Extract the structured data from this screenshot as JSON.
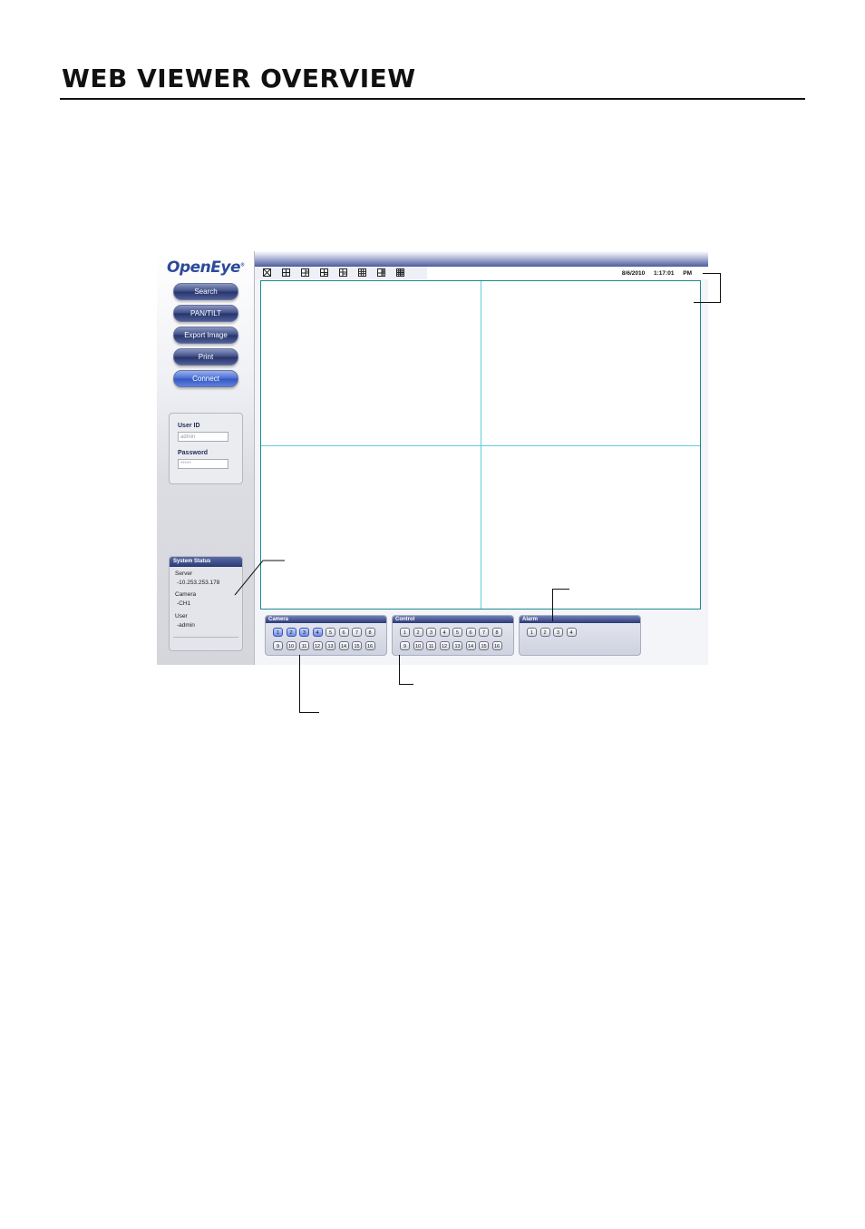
{
  "page": {
    "title": "WEB VIEWER OVERVIEW"
  },
  "app": {
    "logo": "OpenEye",
    "logo_mark": "®",
    "buttons": [
      "Search",
      "PAN/TILT",
      "Export Image",
      "Print",
      "Connect"
    ],
    "login": {
      "user_id_label": "User ID",
      "user_id_value": "admin",
      "password_label": "Password",
      "password_value": "*****"
    },
    "system_status": {
      "title": "System Status",
      "server_label": "Server",
      "server_value": "-10.253.253.178",
      "camera_label": "Camera",
      "camera_value": "-CH1",
      "user_label": "User",
      "user_value": "-admin"
    },
    "date": "8/6/2010",
    "time": "1:17:01 PM",
    "camera_panel": {
      "title": "Camera",
      "numbers": [
        "1",
        "2",
        "3",
        "4",
        "5",
        "6",
        "7",
        "8",
        "9",
        "10",
        "11",
        "12",
        "13",
        "14",
        "15",
        "16"
      ],
      "selected": [
        "1",
        "2",
        "3",
        "4"
      ]
    },
    "control_panel": {
      "title": "Control",
      "numbers": [
        "1",
        "2",
        "3",
        "4",
        "5",
        "6",
        "7",
        "8",
        "9",
        "10",
        "11",
        "12",
        "13",
        "14",
        "15",
        "16"
      ]
    },
    "alarm_panel": {
      "title": "Alarm",
      "numbers": [
        "1",
        "2",
        "3",
        "4"
      ]
    }
  }
}
